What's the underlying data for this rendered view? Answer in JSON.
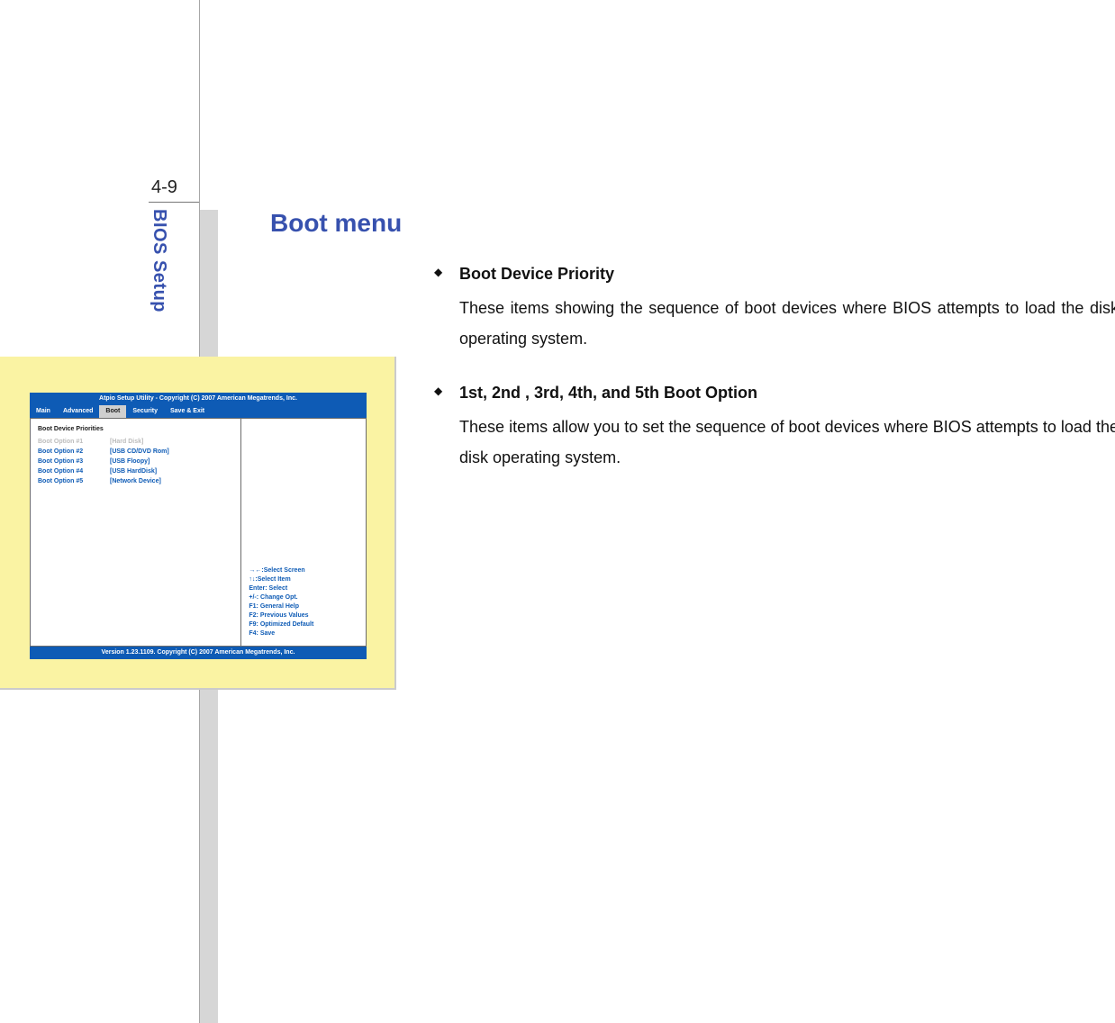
{
  "page_number": "4-9",
  "side_label": "BIOS Setup",
  "title": "Boot menu",
  "bullets": [
    {
      "head": "Boot Device Priority",
      "body": "These items showing the sequence of boot devices where BIOS attempts to load the disk operating system."
    },
    {
      "head": "1st, 2nd , 3rd, 4th, and 5th Boot Option",
      "body": "These items allow you to set the sequence of boot devices where BIOS attempts to load the disk operating system."
    }
  ],
  "bios": {
    "top_bar": "Atpio Setup Utility - Copyright (C) 2007 American Megatrends, Inc.",
    "tabs": [
      "Main",
      "Advanced",
      "Boot",
      "Security",
      "Save & Exit"
    ],
    "selected_tab": "Boot",
    "header": "Boot Device Priorities",
    "rows": [
      {
        "k": "Boot Option #1",
        "v": "[Hard Disk]",
        "sel": true
      },
      {
        "k": "Boot Option #2",
        "v": "[USB CD/DVD Rom]",
        "sel": false
      },
      {
        "k": "Boot Option #3",
        "v": "[USB Floopy]",
        "sel": false
      },
      {
        "k": "Boot Option #4",
        "v": "[USB HardDisk]",
        "sel": false
      },
      {
        "k": "Boot Option #5",
        "v": "[Network Device]",
        "sel": false
      }
    ],
    "help": [
      "→←:Select Screen",
      "↑↓:Select Item",
      "Enter: Select",
      "+/-: Change Opt.",
      "F1: General Help",
      "F2: Previous Values",
      "F9: Optimized Default",
      "F4: Save"
    ],
    "bottom_bar": "Version 1.23.1109. Copyright (C) 2007 American Megatrends, Inc."
  }
}
